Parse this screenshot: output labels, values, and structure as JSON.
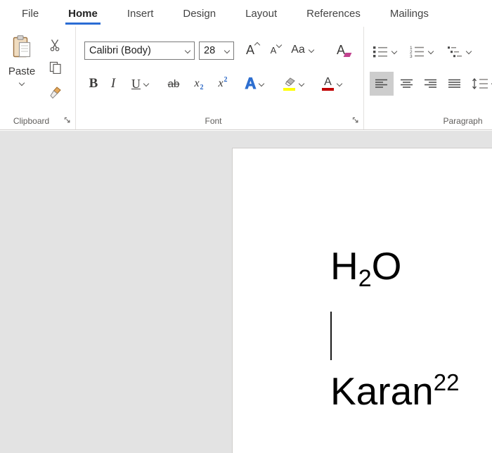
{
  "menu_tabs": [
    "File",
    "Home",
    "Insert",
    "Design",
    "Layout",
    "References",
    "Mailings"
  ],
  "active_tab": "Home",
  "ribbon": {
    "clipboard": {
      "group_label": "Clipboard",
      "paste_label": "Paste"
    },
    "font": {
      "group_label": "Font",
      "font_name_value": "Calibri (Body)",
      "font_size_value": "28",
      "grow_font_glyph": "A",
      "shrink_font_glyph": "A",
      "change_case_glyph": "Aa",
      "clear_formatting_glyph": "A",
      "bold_glyph": "B",
      "italic_glyph": "I",
      "underline_glyph": "U",
      "strikethrough_glyph": "ab",
      "subscript_glyph": "x",
      "subscript_mark": "2",
      "superscript_glyph": "x",
      "superscript_mark": "2",
      "text_effects_glyph": "A",
      "font_color_glyph": "A"
    },
    "paragraph": {
      "group_label": "Paragraph"
    }
  },
  "document": {
    "line1": {
      "base": "H",
      "subscript": "2",
      "tail": "O"
    },
    "line2": {
      "base": "Karan",
      "superscript": "22"
    }
  },
  "icons": {
    "paste": "clipboard-icon",
    "cut": "scissors-icon",
    "copy": "copy-pages-icon",
    "format_painter": "paintbrush-icon",
    "bullets": "bullet-list-icon",
    "numbering": "numbered-list-icon",
    "multilevel": "multilevel-list-icon",
    "align_left": "align-left-icon",
    "align_center": "align-center-icon",
    "align_right": "align-right-icon",
    "justify": "justify-icon",
    "line_spacing": "line-spacing-icon",
    "highlight": "highlighter-icon",
    "dialog_launcher": "dialog-launcher-icon",
    "dropdown": "chevron-down-icon"
  },
  "colors": {
    "active_tab_underline": "#2b6cd4",
    "highlight_yellow": "#ffff00",
    "font_color_red": "#c00000",
    "text_effects_blue": "#2e6fd0",
    "selected_button_bg": "#cdcdcd",
    "doc_background": "#e3e3e3"
  }
}
